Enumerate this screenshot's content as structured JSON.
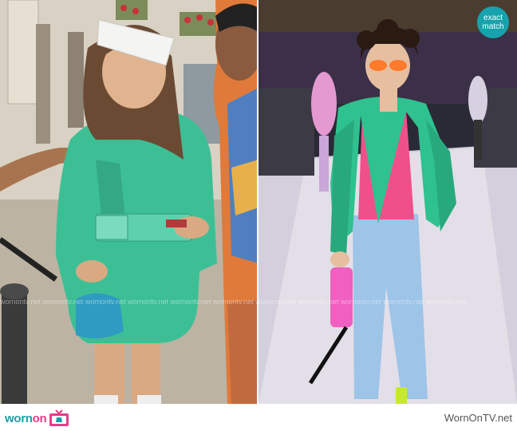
{
  "badge": {
    "line1": "exact",
    "line2": "match"
  },
  "watermark": "wornontv.net wornontv.net wornontv.net wornontv.net wornontv.net wornontv.net wornontv.net wornontv.net wornontv.net wornontv.net wornontv.net",
  "footer": {
    "logo_part1": "worn",
    "logo_part2": "on",
    "site": "WornOnTV.net"
  },
  "colors": {
    "teal": "#17a3ad",
    "pink": "#e83b8a",
    "jacket_green": "#3dbf95"
  }
}
